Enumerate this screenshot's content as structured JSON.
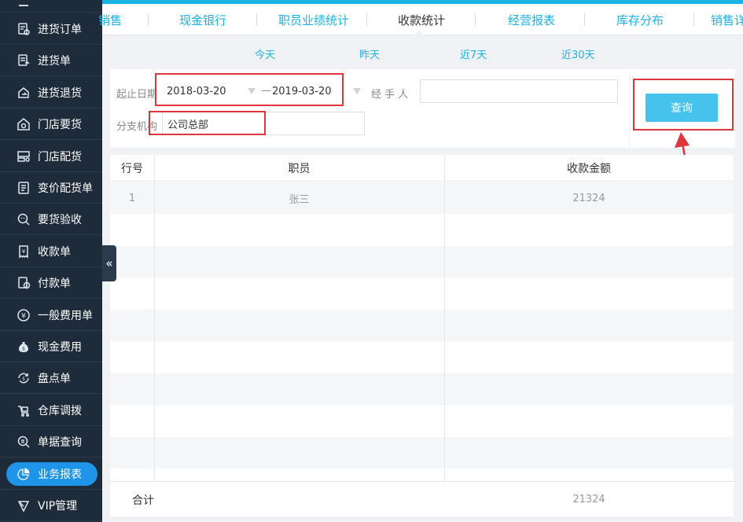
{
  "sidebar": {
    "items": [
      {
        "label": "进货订单",
        "icon": "purchase-order-icon"
      },
      {
        "label": "进货单",
        "icon": "purchase-receipt-icon"
      },
      {
        "label": "进货退货",
        "icon": "purchase-return-icon"
      },
      {
        "label": "门店要货",
        "icon": "store-request-icon"
      },
      {
        "label": "门店配货",
        "icon": "store-distribution-icon"
      },
      {
        "label": "变价配货单",
        "icon": "price-change-distribution-icon"
      },
      {
        "label": "要货验收",
        "icon": "request-inspection-icon"
      },
      {
        "label": "收款单",
        "icon": "receipt-icon"
      },
      {
        "label": "付款单",
        "icon": "payment-icon"
      },
      {
        "label": "一般费用单",
        "icon": "yen-circle-icon"
      },
      {
        "label": "现金费用",
        "icon": "money-bag-icon"
      },
      {
        "label": "盘点单",
        "icon": "inventory-check-icon"
      },
      {
        "label": "仓库调拨",
        "icon": "warehouse-transfer-icon"
      },
      {
        "label": "单据查询",
        "icon": "document-search-icon"
      },
      {
        "label": "业务报表",
        "icon": "pie-chart-icon"
      },
      {
        "label": "VIP管理",
        "icon": "vip-icon"
      }
    ],
    "active_index": 14,
    "collapse_glyph": "«"
  },
  "tabs": [
    {
      "label": "销售"
    },
    {
      "label": "现金银行"
    },
    {
      "label": "职员业绩统计"
    },
    {
      "label": "收款统计"
    },
    {
      "label": "经营报表"
    },
    {
      "label": "库存分布"
    },
    {
      "label": "销售详"
    }
  ],
  "active_tab_index": 3,
  "quick_dates": [
    "今天",
    "昨天",
    "近7天",
    "近30天"
  ],
  "filters": {
    "date_label": "起止日期",
    "date_from": "2018-03-20",
    "date_separator": "—",
    "date_to": "2019-03-20",
    "handler_label": "经 手 人",
    "handler_value": "",
    "branch_label": "分支机构",
    "branch_value": "公司总部"
  },
  "query_button": "查询",
  "table": {
    "columns": [
      "行号",
      "职员",
      "收款金额"
    ],
    "rows": [
      {
        "index": "1",
        "employee": "张三",
        "amount": "21324"
      }
    ],
    "empty_row_count": 9,
    "footer_label": "合计",
    "footer_total": "21324"
  },
  "colors": {
    "accent": "#1ab3e6",
    "sidebar_bg": "#1e2b3a",
    "active_pill": "#1e95e8",
    "button": "#45c3ec",
    "highlight_red": "#e0353b"
  }
}
